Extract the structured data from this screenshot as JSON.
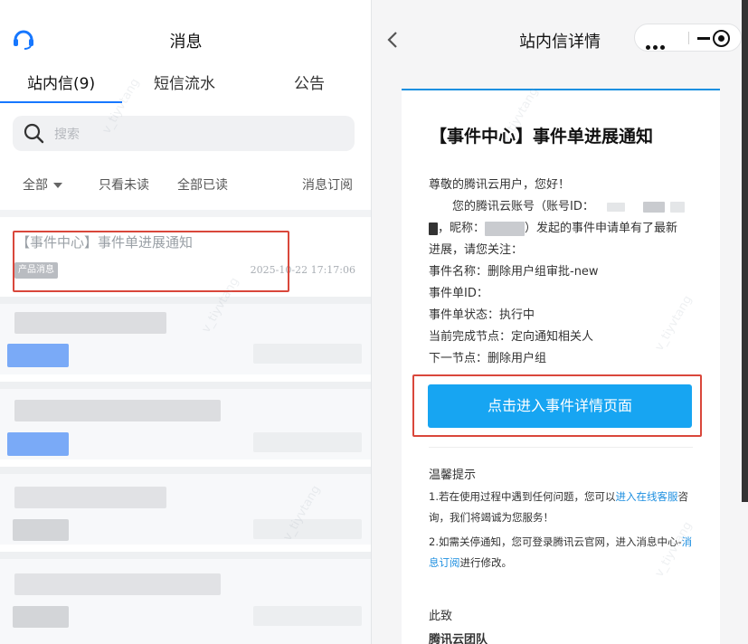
{
  "left": {
    "title": "消息",
    "tabs": [
      {
        "label": "站内信(9)"
      },
      {
        "label": "短信流水"
      },
      {
        "label": "公告"
      }
    ],
    "search_placeholder": "搜索",
    "filters": {
      "all": "全部",
      "unread_only": "只看未读",
      "mark_all_read": "全部已读",
      "subscribe": "消息订阅"
    },
    "first_message": {
      "title": "【事件中心】事件单进展通知",
      "tag": "产品消息",
      "time": "2025-10-22 17:17:06"
    }
  },
  "right": {
    "title": "站内信详情",
    "watermark": "v_tiyvtang",
    "card": {
      "heading": "【事件中心】事件单进展通知",
      "greeting": "尊敬的腾讯云用户，您好！",
      "account_line_1": "您的腾讯云账号（账号ID：",
      "account_line_2_a": "，昵称：",
      "account_line_2_b": "）发起的事件申请单有了最新",
      "account_line_3": "进展，请您关注：",
      "event_name": "事件名称：删除用户组审批-new",
      "event_id": "事件单ID：",
      "event_status": "事件单状态：执行中",
      "current_node": "当前完成节点：定向通知相关人",
      "next_node": "下一节点：删除用户组",
      "cta_label": "点击进入事件详情页面",
      "tips_title": "温馨提示",
      "tip1_a": "1.若在使用过程中遇到任何问题，您可以",
      "tip1_link": "进入在线客服",
      "tip1_b": "咨询，我们将竭诚为您服务！",
      "tip2_a": "2.如需关停通知，您可登录腾讯云官网，进入消息中心-",
      "tip2_link": "消息订阅",
      "tip2_b": "进行修改。",
      "sign_1": "此致",
      "sign_2": "腾讯云团队"
    }
  },
  "colors": {
    "accent_blue": "#1677ff",
    "cta_blue": "#17a5f2",
    "highlight_red": "#d9473b",
    "link_blue": "#1d8fe0"
  }
}
